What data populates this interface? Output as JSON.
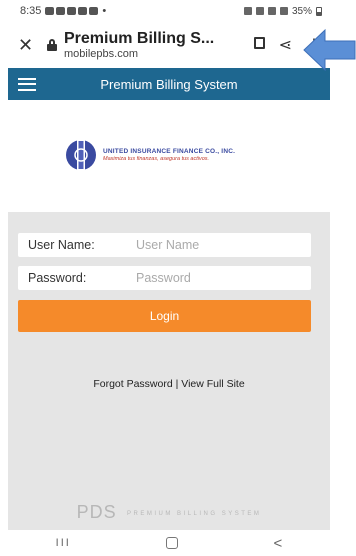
{
  "status_bar": {
    "time": "8:35",
    "dot": "•",
    "battery": "35%"
  },
  "browser": {
    "close": "✕",
    "title": "Premium Billing S...",
    "domain": "mobilepbs.com",
    "share": "⋖",
    "more": "⋮"
  },
  "site": {
    "header_title": "Premium Billing System"
  },
  "logo": {
    "company": "UNITED INSURANCE FINANCE CO., INC.",
    "tagline": "Maximiza tus finanzas, asegura tus activos."
  },
  "login": {
    "username_label": "User Name:",
    "username_placeholder": "User Name",
    "password_label": "Password:",
    "password_placeholder": "Password",
    "login_button": "Login",
    "forgot_password": "Forgot Password",
    "separator": " | ",
    "view_full_site": "View Full Site"
  },
  "footer": {
    "pds": "PDS",
    "tagline": "PREMIUM BILLING SYSTEM"
  },
  "nav": {
    "recents": "III",
    "back": "<"
  },
  "colors": {
    "header_blue": "#1e6790",
    "login_orange": "#f58a2a",
    "panel_gray": "#e5e5e5",
    "arrow_blue": "#5b8fd6"
  },
  "icons": [
    "close-icon",
    "lock-icon",
    "bookmark-icon",
    "share-icon",
    "more-icon",
    "hamburger-icon",
    "recents-icon",
    "home-icon",
    "back-icon",
    "arrow-annotation"
  ]
}
